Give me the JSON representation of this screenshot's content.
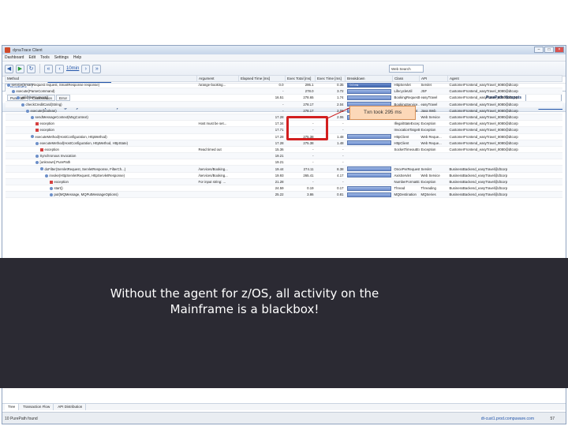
{
  "window": {
    "title": "dynaTrace Client",
    "buttons": [
      "–",
      "□",
      "×"
    ]
  },
  "menu": [
    "Dashboard",
    "Edit",
    "Tools",
    "Settings",
    "Help"
  ],
  "toolbar": {
    "time_link": "10min",
    "search_value": "Web Search"
  },
  "breadcrumb": {
    "prefix": "Web Search showing data",
    "link": "from yesterday 10:48 to yesterday 10:58"
  },
  "tab_label": "PurePaths",
  "filters": [
    "PurePath",
    "Combination",
    "Error"
  ],
  "hotspots": {
    "title": "PurePath Hotspots"
  },
  "tree": {
    "title": "Pure Path Tree (showing only relevant nodes)",
    "show_all": "Show all nodes",
    "columns": [
      "Method",
      "Argument",
      "Elapsed Time [ms]",
      "Exec Total [ms]",
      "Exec Time [ms]",
      "Breakdown",
      "Class",
      "API",
      "Agent"
    ],
    "rows": [
      {
        "method": "service(SmartRequest request, SmartResponse response)",
        "arg": "/orange-booking...",
        "elapsed": "0.0",
        "total": "295.1",
        "time": "0.35",
        "bar": "0.0 ms",
        "cls": "HttpServlet",
        "api": "Servlet",
        "agent": "CustomerFrontend_easyTravel_8080@dtcorp"
      },
      {
        "method": "execute(ParseCommand)",
        "arg": "",
        "elapsed": "-",
        "total": "278.0",
        "time": "3.72",
        "bar": "",
        "cls": "LifecycleUtil",
        "api": "JSF",
        "agent": "CustomerFrontend_easyTravel_8080@dtcorp"
      },
      {
        "method": "validatePayment()",
        "arg": "",
        "elapsed": "16.51",
        "total": "278.65",
        "time": "1.74",
        "bar": "",
        "cls": "BookingRequestB...",
        "api": "easyTravel",
        "agent": "CustomerFrontend_easyTravel_8080@dtcorp"
      },
      {
        "method": "checkCreditCard(String)",
        "arg": "",
        "elapsed": "-",
        "total": "278.17",
        "time": "2.04",
        "bar": "",
        "cls": "BookingService...",
        "api": "easyTravel",
        "agent": "CustomerFrontend_easyTravel_8080@dtcorp"
      },
      {
        "method": "execute(boolean)",
        "arg": "",
        "elapsed": "-",
        "total": "278.17",
        "time": "2.06",
        "bar": "",
        "cls": "OperationClient",
        "api": "Java Web",
        "agent": "CustomerFrontend_easyTravel_8080@dtcorp"
      },
      {
        "method": "sendMessageContext(MsgContext)",
        "arg": "",
        "elapsed": "17.28",
        "total": "278.17",
        "time": "2.06",
        "bar": "",
        "cls": "AxisEngine",
        "api": "Web Service",
        "agent": "CustomerFrontend_easyTravel_8080@dtcorp"
      },
      {
        "method": "exception",
        "arg": "Host must be set...",
        "elapsed": "17.34",
        "total": "-",
        "time": "-",
        "bar": "",
        "cls": "IllegalStateExcepti...",
        "api": "Exception",
        "agent": "CustomerFrontend_easyTravel_8080@dtcorp"
      },
      {
        "method": "exception",
        "arg": "",
        "elapsed": "17.71",
        "total": "-",
        "time": "-",
        "bar": "",
        "cls": "InvocationTargetE...",
        "api": "Exception",
        "agent": "CustomerFrontend_easyTravel_8080@dtcorp"
      },
      {
        "method": "executeMethod(HostConfiguration, HttpMethod)",
        "arg": "",
        "elapsed": "17.28",
        "total": "275.38",
        "time": "1.48",
        "bar": "",
        "cls": "HttpClient",
        "api": "Web Reque...",
        "agent": "CustomerFrontend_easyTravel_8080@dtcorp"
      },
      {
        "method": "executeMethod(HostConfiguration, HttpMethod, HttpState)",
        "arg": "",
        "elapsed": "17.28",
        "total": "275.38",
        "time": "1.48",
        "bar": "",
        "cls": "HttpClient",
        "api": "Web Reque...",
        "agent": "CustomerFrontend_easyTravel_8080@dtcorp"
      },
      {
        "method": "exception",
        "arg": "Read timed out",
        "elapsed": "15.36",
        "total": "-",
        "time": "-",
        "bar": "",
        "cls": "SocketTimeoutExc...",
        "api": "Exception",
        "agent": "CustomerFrontend_easyTravel_8080@dtcorp"
      },
      {
        "method": "Synchronous Invocation",
        "arg": "",
        "elapsed": "19.21",
        "total": "-",
        "time": "-",
        "bar": "",
        "cls": "",
        "api": "",
        "agent": ""
      },
      {
        "method": "[unknown] PurePath",
        "arg": "",
        "elapsed": "19.21",
        "total": "-",
        "time": "-",
        "bar": "",
        "cls": "",
        "api": "",
        "agent": ""
      },
      {
        "method": "doFilter(ServletRequest, ServletResponse, FilterCh...)",
        "arg": "/services/Booking...",
        "elapsed": "19.44",
        "total": "274.11",
        "time": "8.38",
        "bar": "",
        "cls": "OncePerRequestF...",
        "api": "Servlet",
        "agent": "BusinessBackend_easyTravel@dtcorp"
      },
      {
        "method": "invoke(HttpServletRequest, HttpServletResponse)",
        "arg": "/services/Booking...",
        "elapsed": "19.93",
        "total": "265.41",
        "time": "4.17",
        "bar": "",
        "cls": "AxisServlet",
        "api": "Web Service",
        "agent": "BusinessBackend_easyTravel@dtcorp"
      },
      {
        "method": "exception",
        "arg": "For input string: ...",
        "elapsed": "21.28",
        "total": "-",
        "time": "-",
        "bar": "",
        "cls": "NumberFormatExc...",
        "api": "Exception",
        "agent": "BusinessBackend_easyTravel@dtcorp"
      },
      {
        "method": "start()",
        "arg": "",
        "elapsed": "24.59",
        "total": "0.19",
        "time": "0.17",
        "bar": "",
        "cls": "Thread",
        "api": "Threading",
        "agent": "BusinessBackend_easyTravel@dtcorp"
      },
      {
        "method": "put(MQMessage, MQPutMessageOptions)",
        "arg": "",
        "elapsed": "25.22",
        "total": "3.86",
        "time": "0.81",
        "bar": "",
        "cls": "MQDestination",
        "api": "MQSeries",
        "agent": "BusinessBackend_easyTravel@dtcorp"
      }
    ]
  },
  "bottom_rows": [
    {
      "method": "process(HTTPRequest, HTTPResponse, InputStream, Str...)",
      "total": "269.63",
      "time": "0.00",
      "cls": "HTTPRequestProc...",
      "api": "Web Servic...",
      "agent": "BusinessBackend_easyTravel@dtcorp"
    },
    {
      "method": "socketRead0(FileDescriptor, byte[], int, int, int)",
      "total": "1.47",
      "time": "1.47",
      "cls": "SocketInputStream",
      "api": "Web Servic...",
      "agent": "BusinessBackend_easyTravel@dtcorp"
    }
  ],
  "footer_tabs": [
    "Tree",
    "Transaction Flow",
    "API Distribution"
  ],
  "status": {
    "left": "10 PurePath found",
    "right": "dt-cust1.prod.compuware.com",
    "count": "57"
  },
  "callout": {
    "text": "Txn took 295 ms"
  },
  "overlay": {
    "line1": "Without the agent for z/OS, all activity on the",
    "line2": "Mainframe is a blackbox!"
  }
}
